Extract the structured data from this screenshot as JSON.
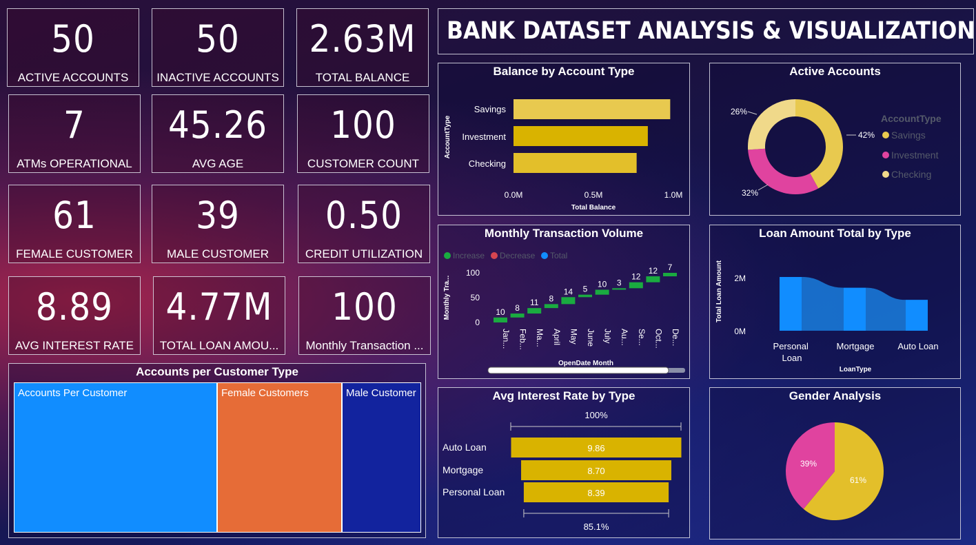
{
  "kpis": [
    {
      "value": "50",
      "label": "ACTIVE ACCOUNTS"
    },
    {
      "value": "50",
      "label": "INACTIVE ACCOUNTS"
    },
    {
      "value": "2.63M",
      "label": "TOTAL BALANCE"
    },
    {
      "value": "7",
      "label": "ATMs OPERATIONAL"
    },
    {
      "value": "45.26",
      "label": "AVG AGE"
    },
    {
      "value": "100",
      "label": "CUSTOMER COUNT"
    },
    {
      "value": "61",
      "label": "FEMALE CUSTOMER"
    },
    {
      "value": "39",
      "label": "MALE CUSTOMER"
    },
    {
      "value": "0.50",
      "label": "CREDIT UTILIZATION"
    },
    {
      "value": "8.89",
      "label": "AVG INTEREST RATE"
    },
    {
      "value": "4.77M",
      "label": "TOTAL LOAN AMOU..."
    },
    {
      "value": "100",
      "label": "Monthly Transaction ..."
    }
  ],
  "header": {
    "title": "BANK DATASET ANALYSIS & VISUALIZATION"
  },
  "colors": {
    "gold": "#d9b300",
    "goldLight": "#e8c94f",
    "pink": "#e0439f",
    "blue": "#118dff",
    "orange": "#e66c37",
    "navy": "#12239e",
    "green": "#1aab40"
  },
  "balance_chart": {
    "title": "Balance by Account Type",
    "type": "bar",
    "orientation": "horizontal",
    "categories": [
      "Savings",
      "Investment",
      "Checking"
    ],
    "values": [
      0.98,
      0.84,
      0.77
    ],
    "ylabel": "AccountType",
    "xlabel": "Total Balance",
    "xticks": [
      "0.0M",
      "0.5M",
      "1.0M"
    ],
    "xlim": [
      0,
      1.0
    ]
  },
  "active_accounts_chart": {
    "title": "Active Accounts",
    "type": "pie",
    "variant": "donut",
    "legend_title": "AccountType",
    "slices": [
      {
        "name": "Savings",
        "value": 42,
        "label": "42%"
      },
      {
        "name": "Investment",
        "value": 32,
        "label": "32%"
      },
      {
        "name": "Checking",
        "value": 26,
        "label": "26%"
      }
    ]
  },
  "monthly_chart": {
    "title": "Monthly Transaction Volume",
    "type": "waterfall",
    "legend": [
      "Increase",
      "Decrease",
      "Total"
    ],
    "ylabel": "Monthly Tra...",
    "xlabel": "OpenDate Month",
    "yticks": [
      "100",
      "50",
      "0"
    ],
    "ylim": [
      0,
      100
    ],
    "months": [
      "Jan...",
      "Feb...",
      "Ma...",
      "April",
      "May",
      "June",
      "July",
      "Au...",
      "Se...",
      "Oct...",
      "De..."
    ],
    "values": [
      10,
      8,
      11,
      8,
      14,
      5,
      10,
      3,
      12,
      12,
      7
    ]
  },
  "loan_chart": {
    "title": "Loan Amount Total by Type",
    "type": "bar",
    "categories": [
      "Personal Loan",
      "Mortgage",
      "Auto Loan"
    ],
    "values": [
      2.0,
      1.6,
      1.15
    ],
    "ylabel": "Total Loan Amount",
    "xlabel": "LoanType",
    "yticks": [
      "2M",
      "0M"
    ]
  },
  "interest_chart": {
    "title": "Avg Interest Rate by Type",
    "type": "funnel",
    "categories": [
      "Auto Loan",
      "Mortgage",
      "Personal Loan"
    ],
    "values": [
      9.86,
      8.7,
      8.39
    ],
    "value_labels": [
      "9.86",
      "8.70",
      "8.39"
    ],
    "top_pct": "100%",
    "bottom_pct": "85.1%"
  },
  "gender_chart": {
    "title": "Gender Analysis",
    "type": "pie",
    "slices": [
      {
        "value": 61,
        "label": "61%"
      },
      {
        "value": 39,
        "label": "39%"
      }
    ]
  },
  "treemap": {
    "title": "Accounts per Customer Type",
    "type": "treemap",
    "items": [
      {
        "label": "Accounts Per Customer",
        "value": 100
      },
      {
        "label": "Female Customers",
        "value": 61
      },
      {
        "label": "Male Customer",
        "value": 39
      }
    ]
  }
}
